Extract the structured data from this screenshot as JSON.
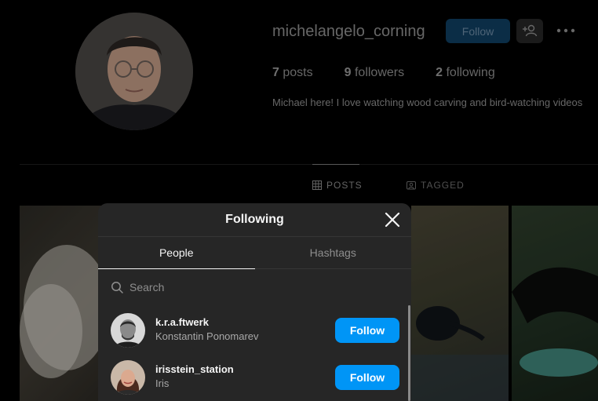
{
  "profile": {
    "username": "michelangelo_corning",
    "follow_label": "Follow",
    "posts_count": "7",
    "posts_label": "posts",
    "followers_count": "9",
    "followers_label": "followers",
    "following_count": "2",
    "following_label": "following",
    "bio": "Michael here! I love watching wood carving and bird-watching videos"
  },
  "profile_tabs": [
    {
      "label": "POSTS",
      "icon": "grid-icon",
      "active": true
    },
    {
      "label": "TAGGED",
      "icon": "tag-icon",
      "active": false
    }
  ],
  "modal": {
    "title": "Following",
    "tabs": [
      {
        "label": "People",
        "active": true
      },
      {
        "label": "Hashtags",
        "active": false
      }
    ],
    "search_placeholder": "Search",
    "users": [
      {
        "username": "k.r.a.ftwerk",
        "full_name": "Konstantin Ponomarev",
        "button": "Follow"
      },
      {
        "username": "irisstein_station",
        "full_name": "Iris",
        "button": "Follow"
      }
    ]
  },
  "colors": {
    "accent": "#0095f6",
    "modal_bg": "#262626",
    "page_bg": "#000000"
  }
}
